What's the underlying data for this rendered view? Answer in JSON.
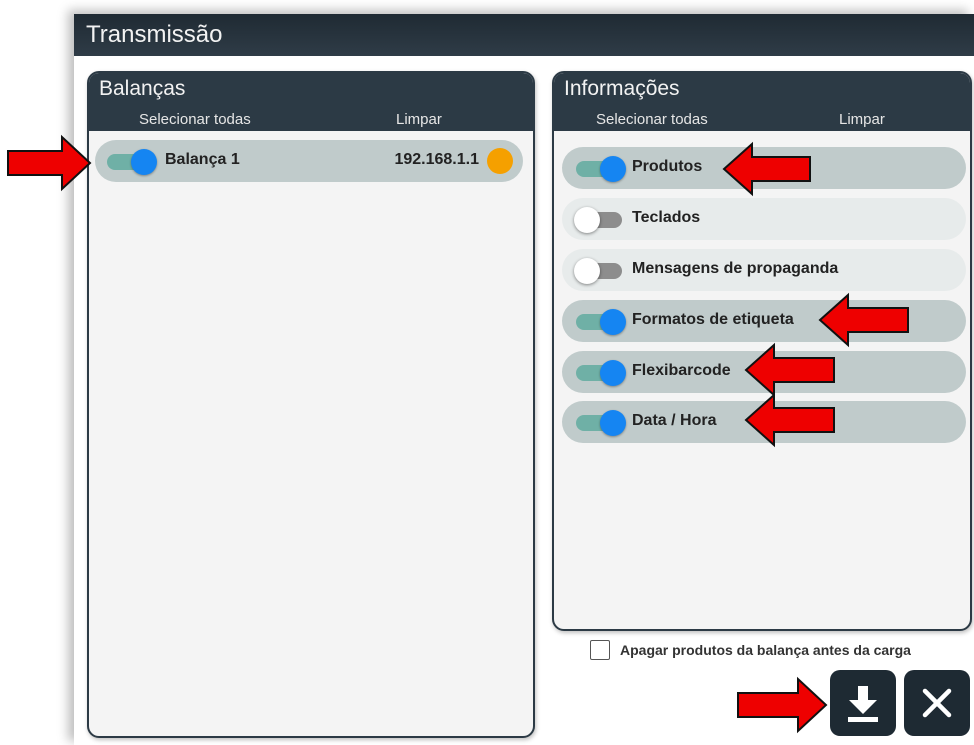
{
  "window": {
    "title": "Transmissão"
  },
  "balancas": {
    "title": "Balanças",
    "select_all": "Selecionar todas",
    "clear": "Limpar",
    "items": [
      {
        "name": "Balança 1",
        "ip": "192.168.1.1",
        "enabled": true,
        "status_color": "#f5a000"
      }
    ]
  },
  "informacoes": {
    "title": "Informações",
    "select_all": "Selecionar todas",
    "clear": "Limpar",
    "items": [
      {
        "label": "Produtos",
        "enabled": true
      },
      {
        "label": "Teclados",
        "enabled": false
      },
      {
        "label": "Mensagens de propaganda",
        "enabled": false
      },
      {
        "label": "Formatos de etiqueta",
        "enabled": true
      },
      {
        "label": "Flexibarcode",
        "enabled": true
      },
      {
        "label": "Data / Hora",
        "enabled": true
      }
    ]
  },
  "options": {
    "delete_products_label": "Apagar produtos da balança antes da carga",
    "delete_products_checked": false
  },
  "actions": {
    "download_icon": "download-icon",
    "close_icon": "close-icon"
  },
  "colors": {
    "header": "#2c3a45",
    "toggle_on": "#1585f2",
    "row_on": "#c0cbcb",
    "annotation_arrow": "#ee0000"
  }
}
